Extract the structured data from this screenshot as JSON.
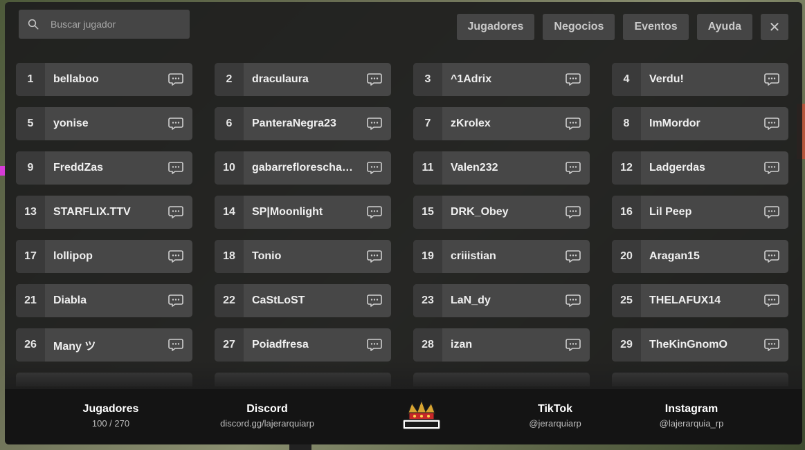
{
  "search": {
    "placeholder": "Buscar jugador"
  },
  "nav": {
    "jugadores": "Jugadores",
    "negocios": "Negocios",
    "eventos": "Eventos",
    "ayuda": "Ayuda",
    "close": "✕"
  },
  "players": [
    {
      "id": "1",
      "name": "bellaboo"
    },
    {
      "id": "2",
      "name": "draculaura"
    },
    {
      "id": "3",
      "name": "^1Adrix"
    },
    {
      "id": "4",
      "name": "Verdu!"
    },
    {
      "id": "5",
      "name": "yonise"
    },
    {
      "id": "6",
      "name": "PanteraNegra23"
    },
    {
      "id": "7",
      "name": "zKrolex"
    },
    {
      "id": "8",
      "name": "ImMordor"
    },
    {
      "id": "9",
      "name": "FreddZas"
    },
    {
      "id": "10",
      "name": "gabarrefloreschavez"
    },
    {
      "id": "11",
      "name": "Valen232"
    },
    {
      "id": "12",
      "name": "Ladgerdas"
    },
    {
      "id": "13",
      "name": "STARFLIX.TTV"
    },
    {
      "id": "14",
      "name": "SP|Moonlight"
    },
    {
      "id": "15",
      "name": "DRK_Obey"
    },
    {
      "id": "16",
      "name": "Lil Peep"
    },
    {
      "id": "17",
      "name": "lollipop"
    },
    {
      "id": "18",
      "name": "Tonio"
    },
    {
      "id": "19",
      "name": "criiistian"
    },
    {
      "id": "20",
      "name": "Aragan15"
    },
    {
      "id": "21",
      "name": "Diabla"
    },
    {
      "id": "22",
      "name": "CaStLoST"
    },
    {
      "id": "23",
      "name": "LaN_dy"
    },
    {
      "id": "25",
      "name": "THELAFUX14"
    },
    {
      "id": "26",
      "name": "Many ツ"
    },
    {
      "id": "27",
      "name": "Poiadfresa"
    },
    {
      "id": "28",
      "name": "izan"
    },
    {
      "id": "29",
      "name": "TheKinGnomO"
    }
  ],
  "footer": {
    "jugadores": {
      "title": "Jugadores",
      "value": "100 / 270"
    },
    "discord": {
      "title": "Discord",
      "value": "discord.gg/lajerarquiarp"
    },
    "logo": {
      "text": "JERARQUIA"
    },
    "tiktok": {
      "title": "TikTok",
      "value": "@jerarquiarp"
    },
    "instagram": {
      "title": "Instagram",
      "value": "@lajerarquia_rp"
    }
  },
  "colors": {
    "panel": "#1e1e1e",
    "card": "#474747",
    "card_number": "#3a3a3a",
    "footer": "#141414",
    "logo_gold": "#d7a431"
  }
}
